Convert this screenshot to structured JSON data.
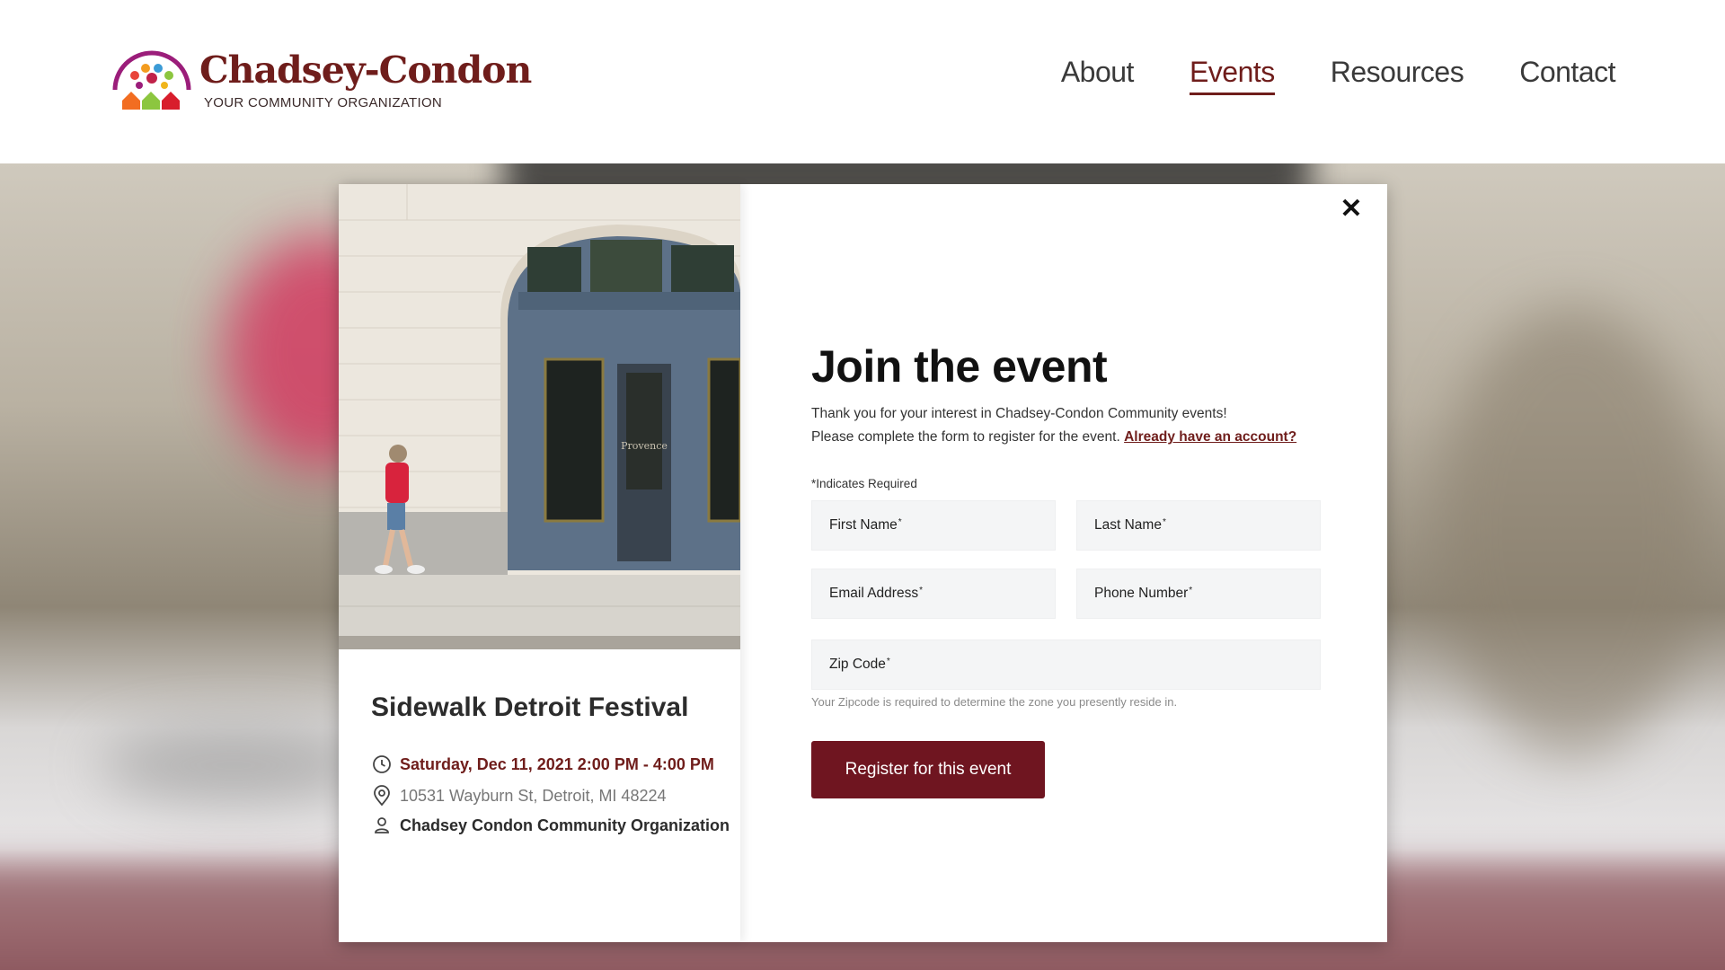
{
  "header": {
    "logo_title": "Chadsey-Condon",
    "logo_tagline": "YOUR COMMUNITY ORGANIZATION",
    "nav": [
      {
        "label": "About",
        "active": false
      },
      {
        "label": "Events",
        "active": true
      },
      {
        "label": "Resources",
        "active": false
      },
      {
        "label": "Contact",
        "active": false
      }
    ]
  },
  "event": {
    "title": "Sidewalk Detroit Festival",
    "datetime": "Saturday, Dec 11, 2021 2:00 PM - 4:00 PM",
    "address": "10531 Wayburn St, Detroit, MI 48224",
    "organizer": "Chadsey Condon Community Organization",
    "photo_sign_text": "Provence"
  },
  "form": {
    "title": "Join the event",
    "intro_line1": "Thank you for your interest in Chadsey-Condon Community events!",
    "intro_line2": "Please complete the form to register for the event.",
    "account_link": "Already have an account?",
    "required_note": "*Indicates Required",
    "fields": {
      "first_name": "First Name",
      "last_name": "Last Name",
      "email": "Email Address",
      "phone": "Phone Number",
      "zip": "Zip Code"
    },
    "required_marker": "*",
    "zip_hint": "Your Zipcode is required to determine the zone you presently reside in.",
    "submit_label": "Register for this event",
    "close_symbol": "✕"
  },
  "colors": {
    "brand": "#6f1d1b",
    "button": "#6f1520",
    "field_bg": "#f4f5f6"
  },
  "icons": [
    "logo-icon",
    "clock-icon",
    "location-pin-icon",
    "person-icon",
    "close-icon"
  ]
}
